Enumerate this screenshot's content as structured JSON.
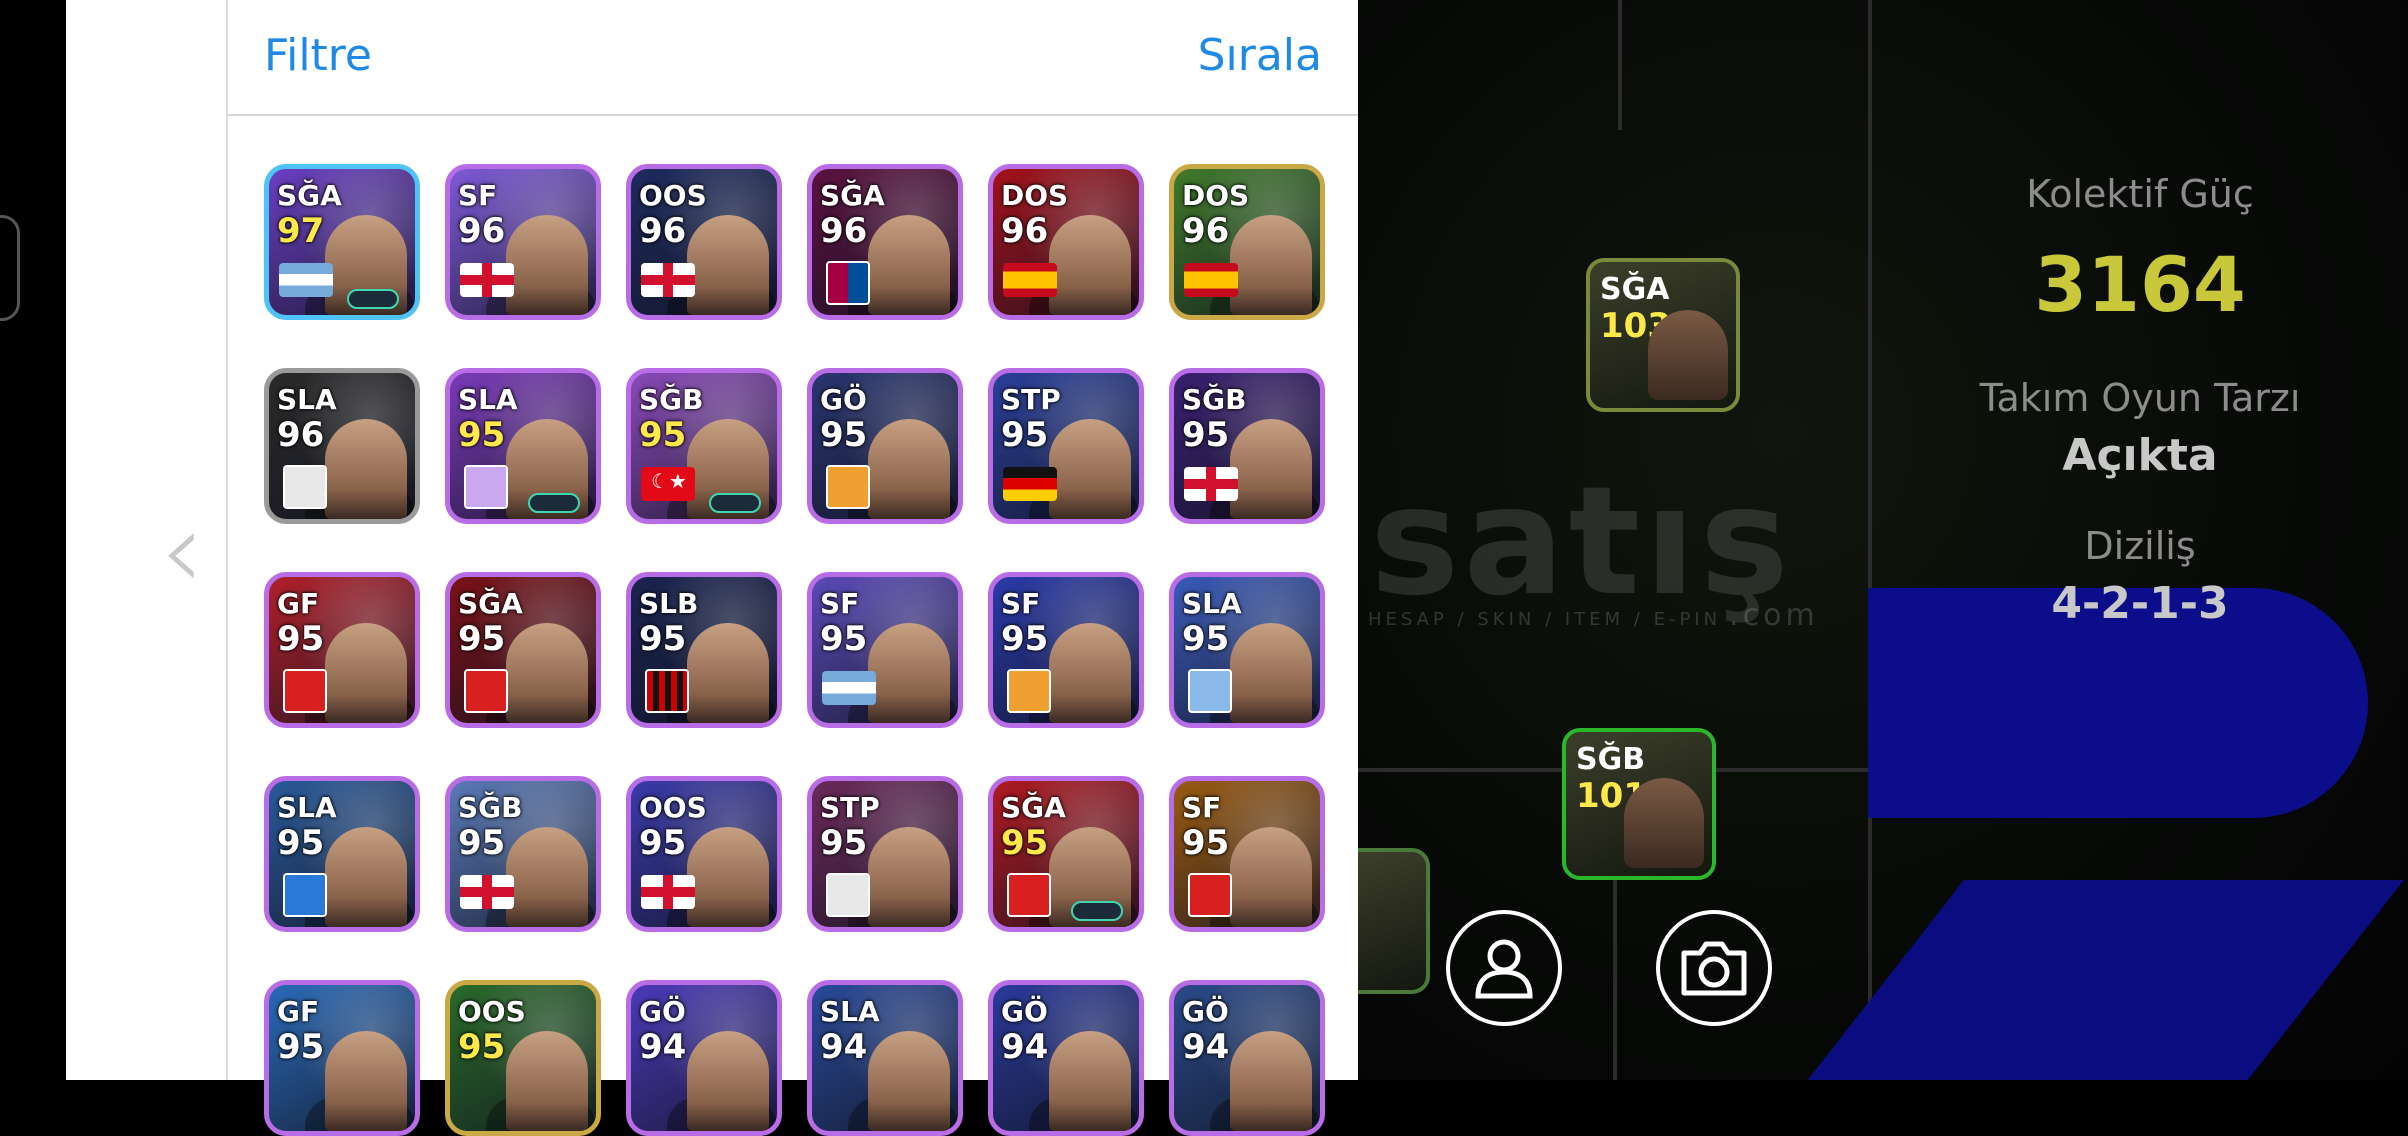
{
  "panel": {
    "filter_label": "Filtre",
    "sort_label": "Sırala"
  },
  "players": [
    {
      "pos": "SĞA",
      "rating": "97",
      "rating_color": "#ffe84a",
      "frame": "#4fc3f7",
      "bg": "#6a3fc2",
      "badge": "flag-ar",
      "chip": true
    },
    {
      "pos": "SF",
      "rating": "96",
      "rating_color": "#ffffff",
      "frame": "#b86ce6",
      "bg": "#7e5ad8",
      "badge": "flag-en",
      "chip": false
    },
    {
      "pos": "OOS",
      "rating": "96",
      "rating_color": "#ffffff",
      "frame": "#b86ce6",
      "bg": "#1e2a5e",
      "badge": "flag-en",
      "chip": false
    },
    {
      "pos": "SĞA",
      "rating": "96",
      "rating_color": "#ffffff",
      "frame": "#b86ce6",
      "bg": "#5b1240",
      "badge": "crest-barca",
      "chip": false
    },
    {
      "pos": "DOS",
      "rating": "96",
      "rating_color": "#ffffff",
      "frame": "#b86ce6",
      "bg": "#a3121c",
      "badge": "flag-es",
      "chip": false
    },
    {
      "pos": "DOS",
      "rating": "96",
      "rating_color": "#ffffff",
      "frame": "#c9a845",
      "bg": "#3f7a2a",
      "badge": "flag-es",
      "chip": false
    },
    {
      "pos": "SLA",
      "rating": "96",
      "rating_color": "#ffffff",
      "frame": "#9a9a9a",
      "bg": "#2a2a2a",
      "badge": "crest-white",
      "chip": false
    },
    {
      "pos": "SLA",
      "rating": "95",
      "rating_color": "#ffe84a",
      "frame": "#b86ce6",
      "bg": "#7a3ab8",
      "badge": "crest-purple",
      "chip": true
    },
    {
      "pos": "SĞB",
      "rating": "95",
      "rating_color": "#ffe84a",
      "frame": "#b86ce6",
      "bg": "#8a4ab8",
      "badge": "flag-tr",
      "chip": true
    },
    {
      "pos": "GÖ",
      "rating": "95",
      "rating_color": "#ffffff",
      "frame": "#b86ce6",
      "bg": "#2a3570",
      "badge": "crest-orange",
      "chip": false
    },
    {
      "pos": "STP",
      "rating": "95",
      "rating_color": "#ffffff",
      "frame": "#b86ce6",
      "bg": "#2a3f9a",
      "badge": "flag-de",
      "chip": false
    },
    {
      "pos": "SĞB",
      "rating": "95",
      "rating_color": "#ffffff",
      "frame": "#b86ce6",
      "bg": "#3a2070",
      "badge": "flag-en",
      "chip": false
    },
    {
      "pos": "GF",
      "rating": "95",
      "rating_color": "#ffffff",
      "frame": "#b86ce6",
      "bg": "#b0202a",
      "badge": "crest-red",
      "chip": false
    },
    {
      "pos": "SĞA",
      "rating": "95",
      "rating_color": "#ffffff",
      "frame": "#b86ce6",
      "bg": "#7a1218",
      "badge": "crest-red",
      "chip": false
    },
    {
      "pos": "SLB",
      "rating": "95",
      "rating_color": "#ffffff",
      "frame": "#b86ce6",
      "bg": "#1a2450",
      "badge": "crest-milan",
      "chip": false
    },
    {
      "pos": "SF",
      "rating": "95",
      "rating_color": "#ffffff",
      "frame": "#b86ce6",
      "bg": "#5a4ab8",
      "badge": "flag-ar",
      "chip": false
    },
    {
      "pos": "SF",
      "rating": "95",
      "rating_color": "#ffffff",
      "frame": "#b86ce6",
      "bg": "#2a3aa8",
      "badge": "crest-orange",
      "chip": false
    },
    {
      "pos": "SLA",
      "rating": "95",
      "rating_color": "#ffffff",
      "frame": "#b86ce6",
      "bg": "#3a5ab8",
      "badge": "crest-lazio",
      "chip": false
    },
    {
      "pos": "SLA",
      "rating": "95",
      "rating_color": "#ffffff",
      "frame": "#b86ce6",
      "bg": "#2a5a9a",
      "badge": "crest-blue",
      "chip": false
    },
    {
      "pos": "SĞB",
      "rating": "95",
      "rating_color": "#ffffff",
      "frame": "#b86ce6",
      "bg": "#5a7ab8",
      "badge": "flag-en",
      "chip": false
    },
    {
      "pos": "OOS",
      "rating": "95",
      "rating_color": "#ffffff",
      "frame": "#b86ce6",
      "bg": "#3a3aa8",
      "badge": "flag-en",
      "chip": false
    },
    {
      "pos": "STP",
      "rating": "95",
      "rating_color": "#ffffff",
      "frame": "#b86ce6",
      "bg": "#6a2a5a",
      "badge": "crest-white",
      "chip": false
    },
    {
      "pos": "SĞA",
      "rating": "95",
      "rating_color": "#ffe84a",
      "frame": "#b86ce6",
      "bg": "#b01a22",
      "badge": "crest-red",
      "chip": true
    },
    {
      "pos": "SF",
      "rating": "95",
      "rating_color": "#ffffff",
      "frame": "#b86ce6",
      "bg": "#9a5a12",
      "badge": "crest-red",
      "chip": false
    },
    {
      "pos": "GF",
      "rating": "95",
      "rating_color": "#ffffff",
      "frame": "#b86ce6",
      "bg": "#2a6ab8",
      "badge": "none",
      "chip": false
    },
    {
      "pos": "OOS",
      "rating": "95",
      "rating_color": "#ffe84a",
      "frame": "#c9a845",
      "bg": "#2a6a2a",
      "badge": "none",
      "chip": false
    },
    {
      "pos": "GÖ",
      "rating": "94",
      "rating_color": "#ffffff",
      "frame": "#b86ce6",
      "bg": "#4a3ab8",
      "badge": "none",
      "chip": false
    },
    {
      "pos": "SLA",
      "rating": "94",
      "rating_color": "#ffffff",
      "frame": "#b86ce6",
      "bg": "#2a4a9a",
      "badge": "none",
      "chip": false
    },
    {
      "pos": "GÖ",
      "rating": "94",
      "rating_color": "#ffffff",
      "frame": "#b86ce6",
      "bg": "#2a3a9a",
      "badge": "none",
      "chip": false
    },
    {
      "pos": "GÖ",
      "rating": "94",
      "rating_color": "#ffffff",
      "frame": "#b86ce6",
      "bg": "#2a4a8a",
      "badge": "none",
      "chip": false
    }
  ],
  "team": {
    "strength_label": "Kolektif Güç",
    "strength_value": "3164",
    "playstyle_label": "Takım Oyun Tarzı",
    "playstyle_value": "Açıkta",
    "formation_label": "Diziliş",
    "formation_value": "4-2-1-3"
  },
  "pitch_players": [
    {
      "pos": "SĞA",
      "rating": "103",
      "frame": "#7a8a3a"
    },
    {
      "pos": "SĞB",
      "rating": "101",
      "frame": "#2ab82a"
    }
  ],
  "watermark": {
    "main": "satış",
    "sub": "HESAP / SKIN / ITEM / E-PIN",
    "domain": ".com"
  },
  "colors": {
    "accent": "#1f8ae6",
    "strength": "#c8c83a"
  }
}
